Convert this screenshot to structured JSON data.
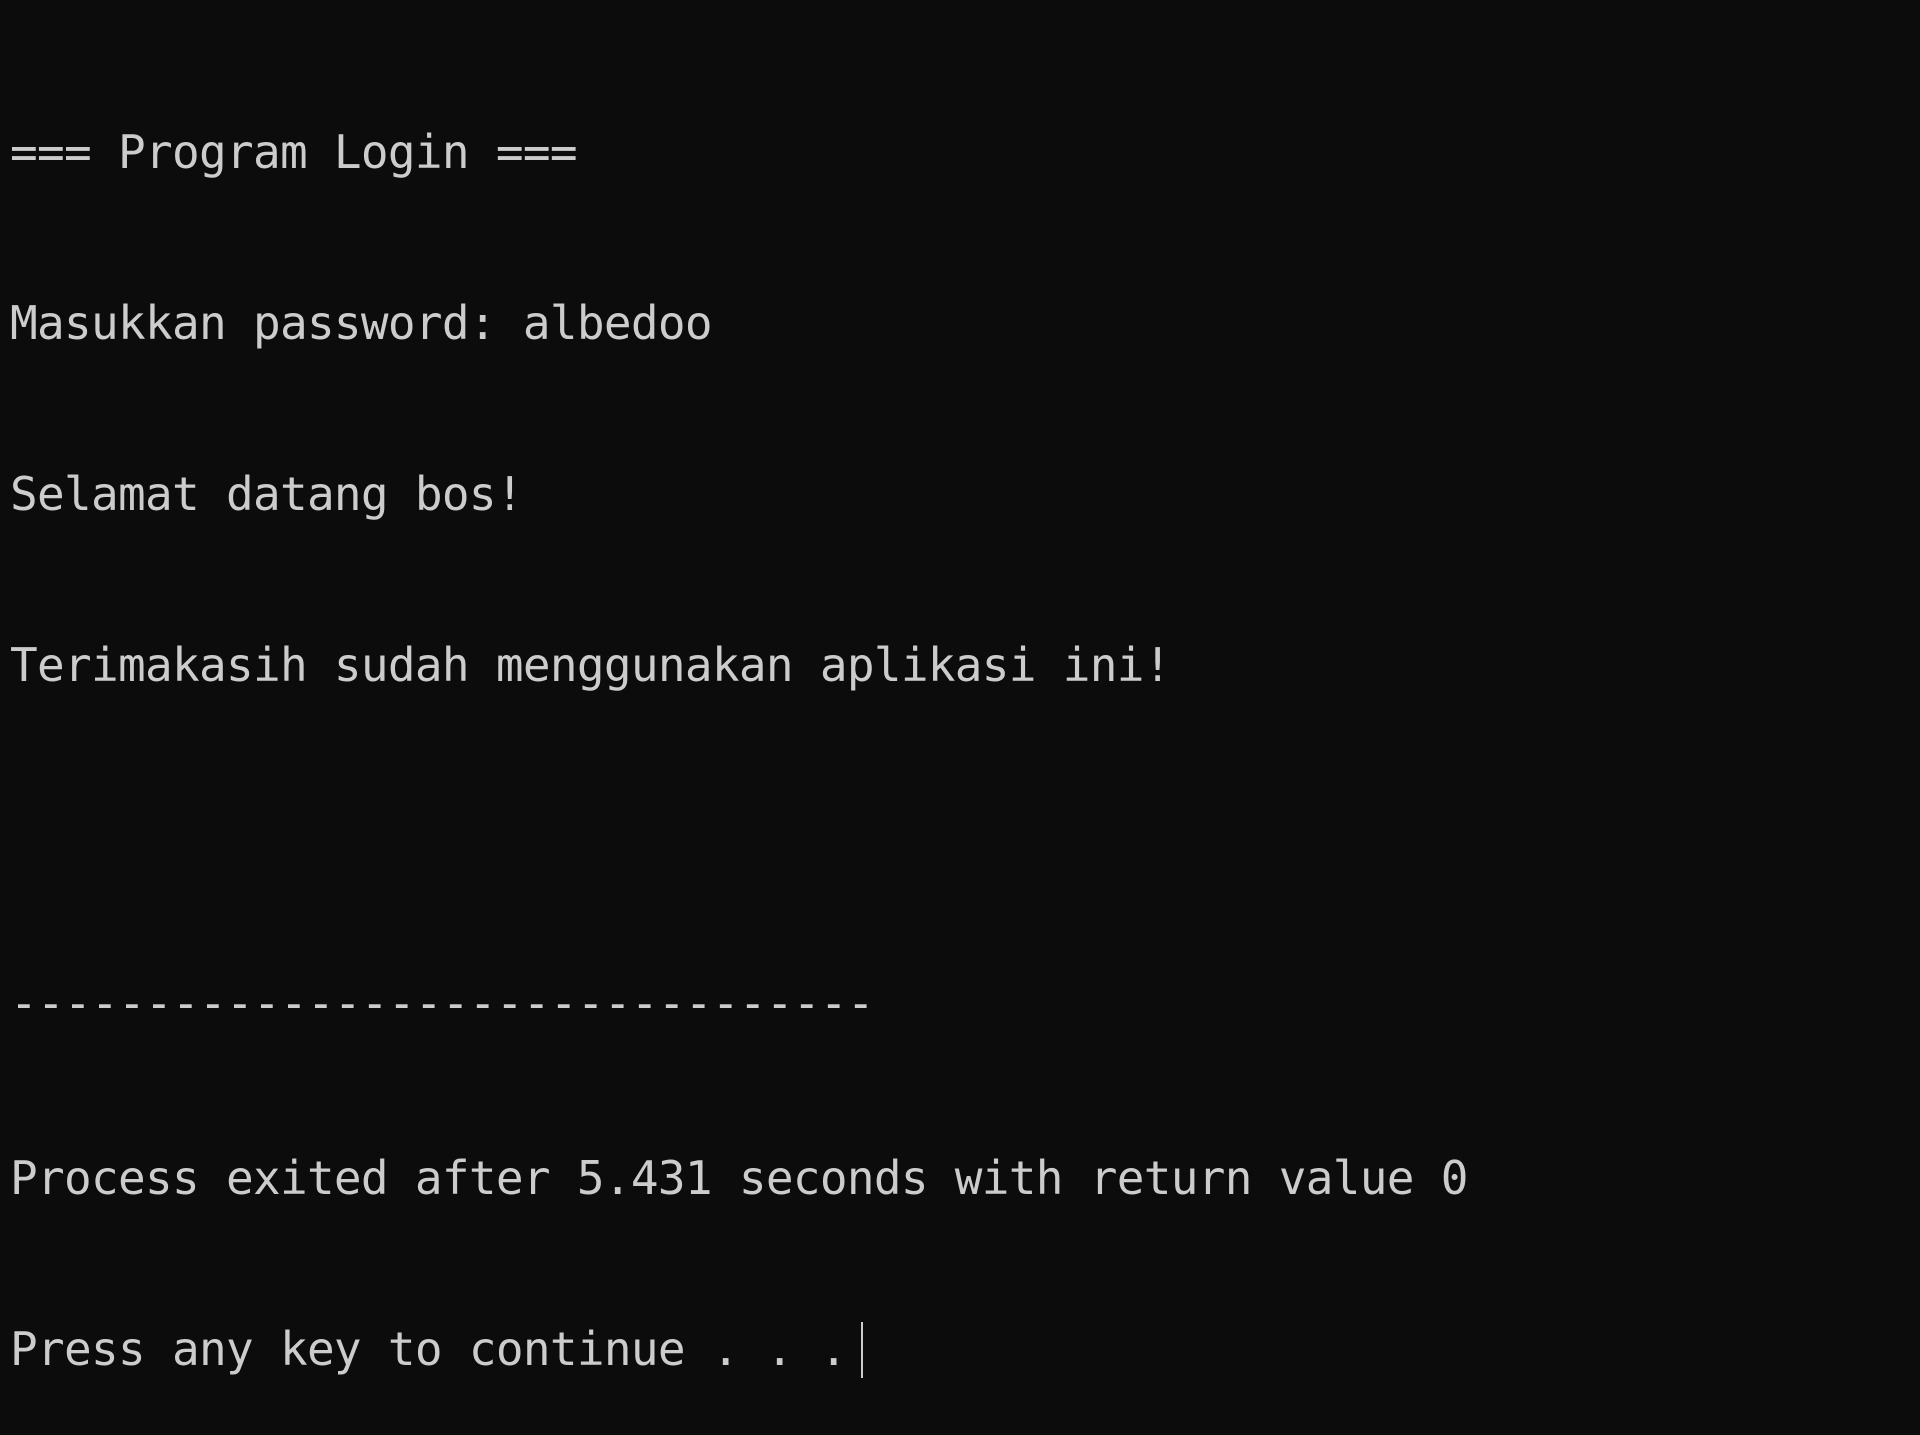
{
  "console": {
    "lines": [
      "=== Program Login ===",
      "Masukkan password: albedoo",
      "Selamat datang bos!",
      "Terimakasih sudah menggunakan aplikasi ini!",
      "",
      "--------------------------------",
      "Process exited after 5.431 seconds with return value 0",
      "Press any key to continue . . ."
    ]
  },
  "colors": {
    "background": "#0c0c0c",
    "text": "#cccccc"
  }
}
